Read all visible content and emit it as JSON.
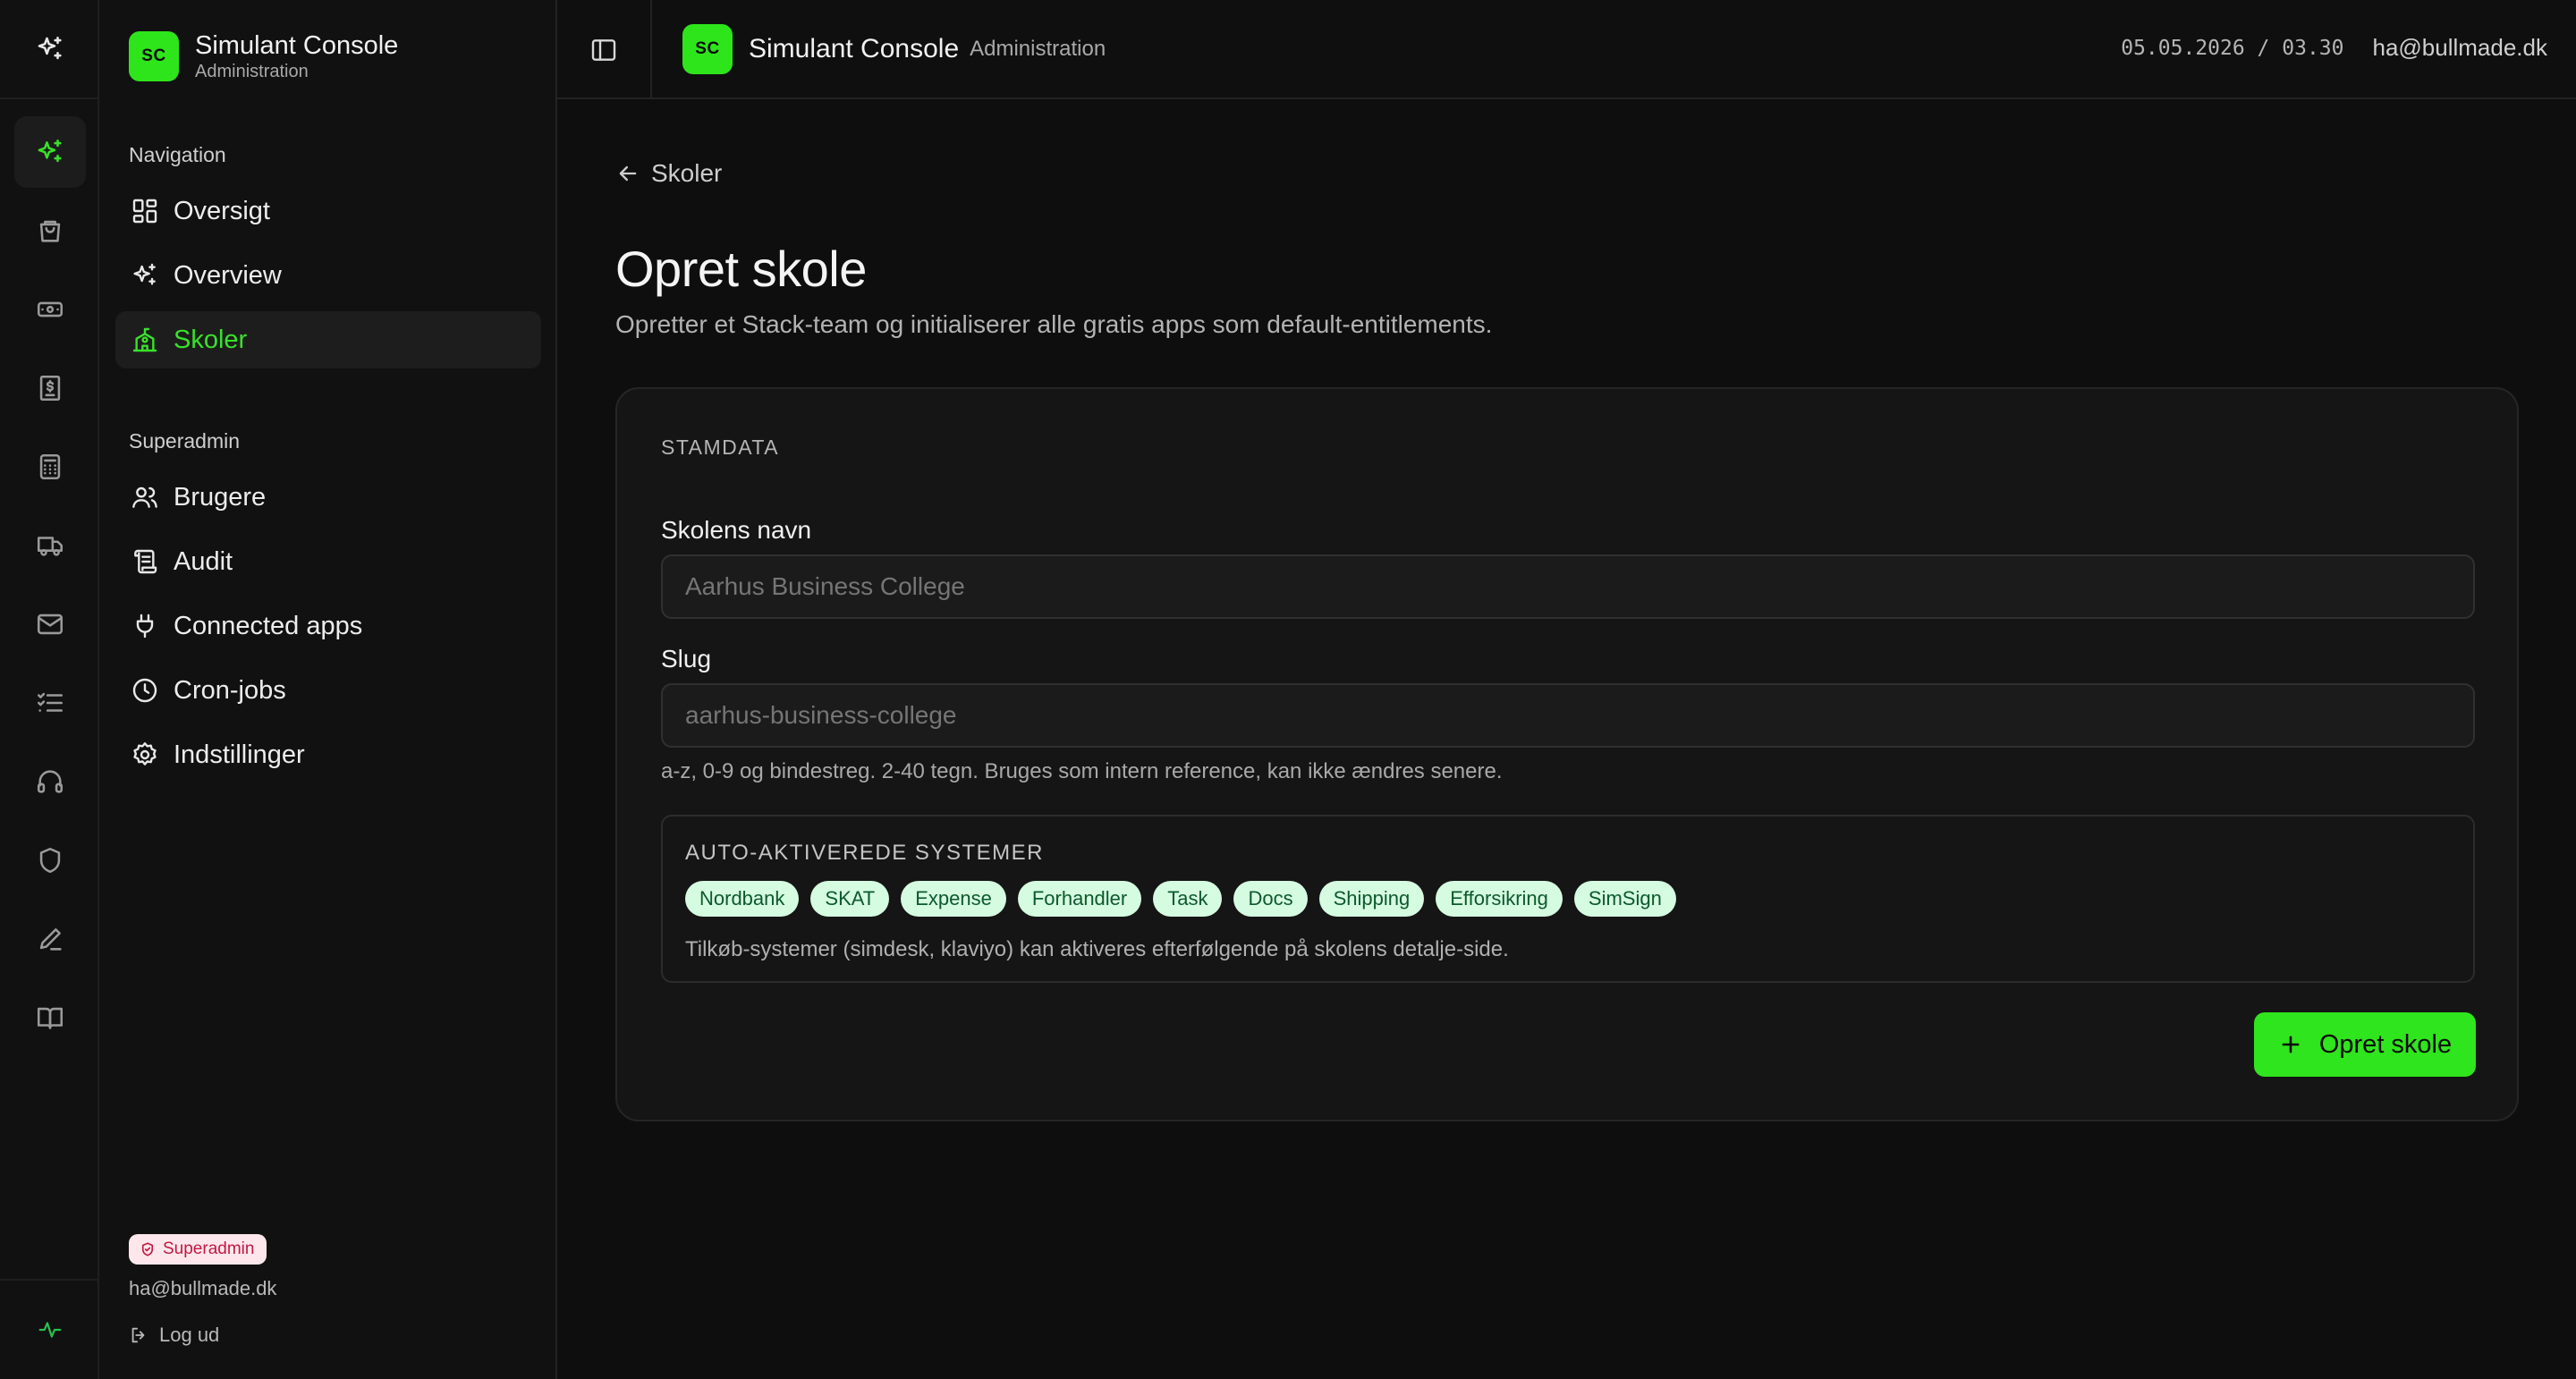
{
  "app": {
    "badge": "SC",
    "title": "Simulant Console",
    "subtitle": "Administration"
  },
  "rail": {
    "icons": [
      "sparkles-icon",
      "shopping-bag-icon",
      "banknote-icon",
      "receipt-dollar-icon",
      "calculator-icon",
      "truck-icon",
      "mail-icon",
      "list-checks-icon",
      "headphones-icon",
      "shield-icon",
      "pen-icon",
      "book-open-icon"
    ],
    "active": "sparkles-icon",
    "bottom_icon": "activity-icon"
  },
  "sidebar": {
    "nav_heading": "Navigation",
    "nav_items": [
      {
        "label": "Oversigt",
        "icon": "dashboard-icon"
      },
      {
        "label": "Overview",
        "icon": "sparkles-icon"
      },
      {
        "label": "Skoler",
        "icon": "school-icon",
        "active": true
      }
    ],
    "superadmin_heading": "Superadmin",
    "superadmin_items": [
      {
        "label": "Brugere",
        "icon": "users-icon"
      },
      {
        "label": "Audit",
        "icon": "scroll-icon"
      },
      {
        "label": "Connected apps",
        "icon": "plug-icon"
      },
      {
        "label": "Cron-jobs",
        "icon": "clock-icon"
      },
      {
        "label": "Indstillinger",
        "icon": "gear-icon"
      }
    ],
    "role_badge": "Superadmin",
    "user_email": "ha@bullmade.dk",
    "logout_label": "Log ud"
  },
  "topbar": {
    "title": "Simulant Console",
    "subtitle": "Administration",
    "datetime": "05.05.2026 / 03.30",
    "email": "ha@bullmade.dk"
  },
  "page": {
    "back_label": "Skoler",
    "title": "Opret skole",
    "description": "Opretter et Stack-team og initialiserer alle gratis apps som default-entitlements."
  },
  "form": {
    "section_label": "STAMDATA",
    "name_label": "Skolens navn",
    "name_placeholder": "Aarhus Business College",
    "slug_label": "Slug",
    "slug_placeholder": "aarhus-business-college",
    "slug_hint": "a-z, 0-9 og bindestreg. 2-40 tegn. Bruges som intern reference, kan ikke ændres senere.",
    "systems_label": "AUTO-AKTIVEREDE SYSTEMER",
    "systems": [
      "Nordbank",
      "SKAT",
      "Expense",
      "Forhandler",
      "Task",
      "Docs",
      "Shipping",
      "Efforsikring",
      "SimSign"
    ],
    "systems_note": "Tilkøb-systemer (simdesk, klaviyo) kan aktiveres efterfølgende på skolens detalje-side.",
    "submit_label": "Opret skole"
  },
  "colors": {
    "accent": "#2ee51b",
    "background": "#0e0e0e",
    "card": "#151515",
    "chip_bg": "#d5fbe0",
    "chip_text": "#0c5a2b",
    "badge_bg": "#fde7ec",
    "badge_text": "#c21741"
  }
}
